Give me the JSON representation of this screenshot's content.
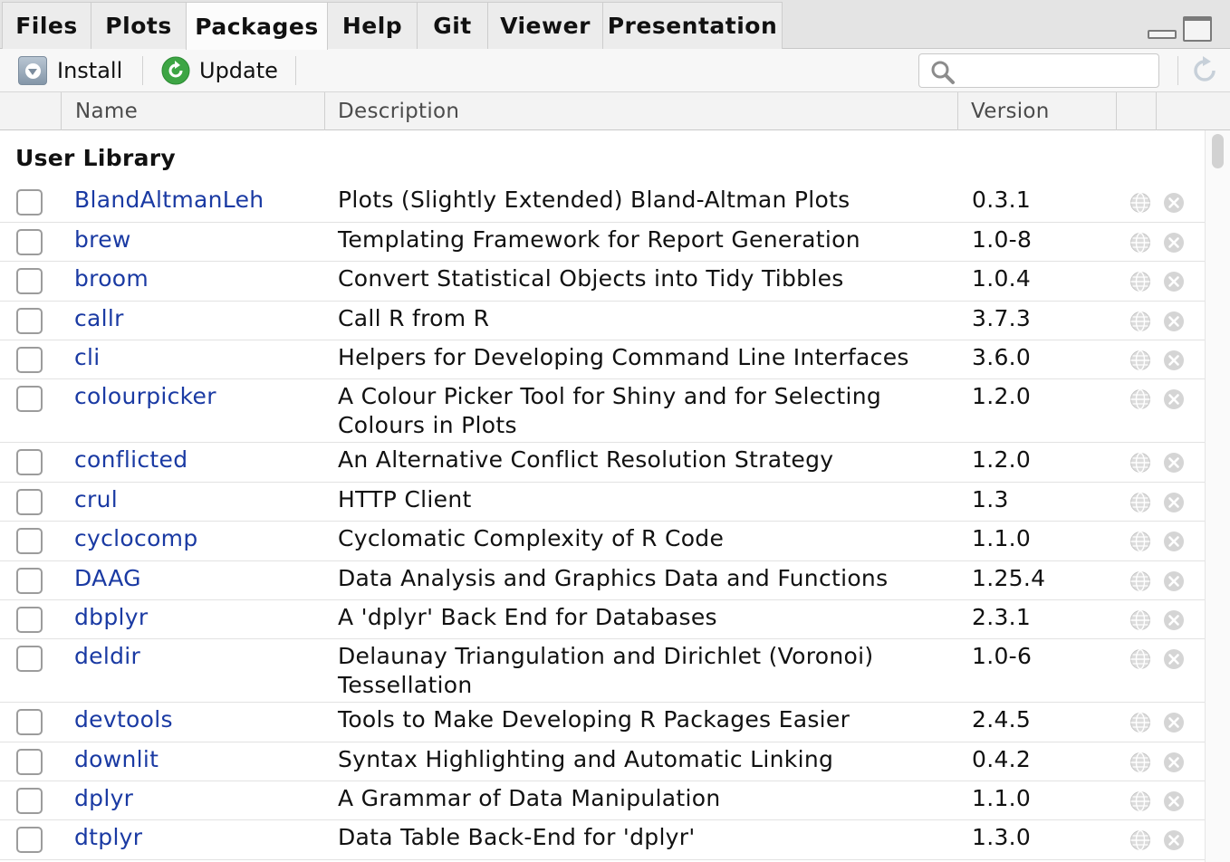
{
  "tabs": [
    {
      "label": "Files",
      "active": false
    },
    {
      "label": "Plots",
      "active": false
    },
    {
      "label": "Packages",
      "active": true
    },
    {
      "label": "Help",
      "active": false
    },
    {
      "label": "Git",
      "active": false
    },
    {
      "label": "Viewer",
      "active": false
    },
    {
      "label": "Presentation",
      "active": false
    }
  ],
  "toolbar": {
    "install_label": "Install",
    "update_label": "Update",
    "search_placeholder": ""
  },
  "columns": {
    "name": "Name",
    "description": "Description",
    "version": "Version"
  },
  "section_title": "User Library",
  "packages": [
    {
      "name": "BlandAltmanLeh",
      "description": "Plots (Slightly Extended) Bland-Altman Plots",
      "version": "0.3.1"
    },
    {
      "name": "brew",
      "description": "Templating Framework for Report Generation",
      "version": "1.0-8"
    },
    {
      "name": "broom",
      "description": "Convert Statistical Objects into Tidy Tibbles",
      "version": "1.0.4"
    },
    {
      "name": "callr",
      "description": "Call R from R",
      "version": "3.7.3"
    },
    {
      "name": "cli",
      "description": "Helpers for Developing Command Line Interfaces",
      "version": "3.6.0"
    },
    {
      "name": "colourpicker",
      "description": "A Colour Picker Tool for Shiny and for Selecting Colours in Plots",
      "version": "1.2.0"
    },
    {
      "name": "conflicted",
      "description": "An Alternative Conflict Resolution Strategy",
      "version": "1.2.0"
    },
    {
      "name": "crul",
      "description": "HTTP Client",
      "version": "1.3"
    },
    {
      "name": "cyclocomp",
      "description": "Cyclomatic Complexity of R Code",
      "version": "1.1.0"
    },
    {
      "name": "DAAG",
      "description": "Data Analysis and Graphics Data and Functions",
      "version": "1.25.4"
    },
    {
      "name": "dbplyr",
      "description": "A 'dplyr' Back End for Databases",
      "version": "2.3.1"
    },
    {
      "name": "deldir",
      "description": "Delaunay Triangulation and Dirichlet (Voronoi) Tessellation",
      "version": "1.0-6"
    },
    {
      "name": "devtools",
      "description": "Tools to Make Developing R Packages Easier",
      "version": "2.4.5"
    },
    {
      "name": "downlit",
      "description": "Syntax Highlighting and Automatic Linking",
      "version": "0.4.2"
    },
    {
      "name": "dplyr",
      "description": "A Grammar of Data Manipulation",
      "version": "1.1.0"
    },
    {
      "name": "dtplyr",
      "description": "Data Table Back-End for 'dplyr'",
      "version": "1.3.0"
    }
  ],
  "icons": {
    "install": "install-icon",
    "update": "update-icon",
    "search": "search-icon",
    "refresh": "refresh-icon",
    "website": "globe-icon",
    "remove": "remove-icon"
  },
  "colors": {
    "package_link": "#1a3aa3",
    "update_green": "#3da544"
  }
}
